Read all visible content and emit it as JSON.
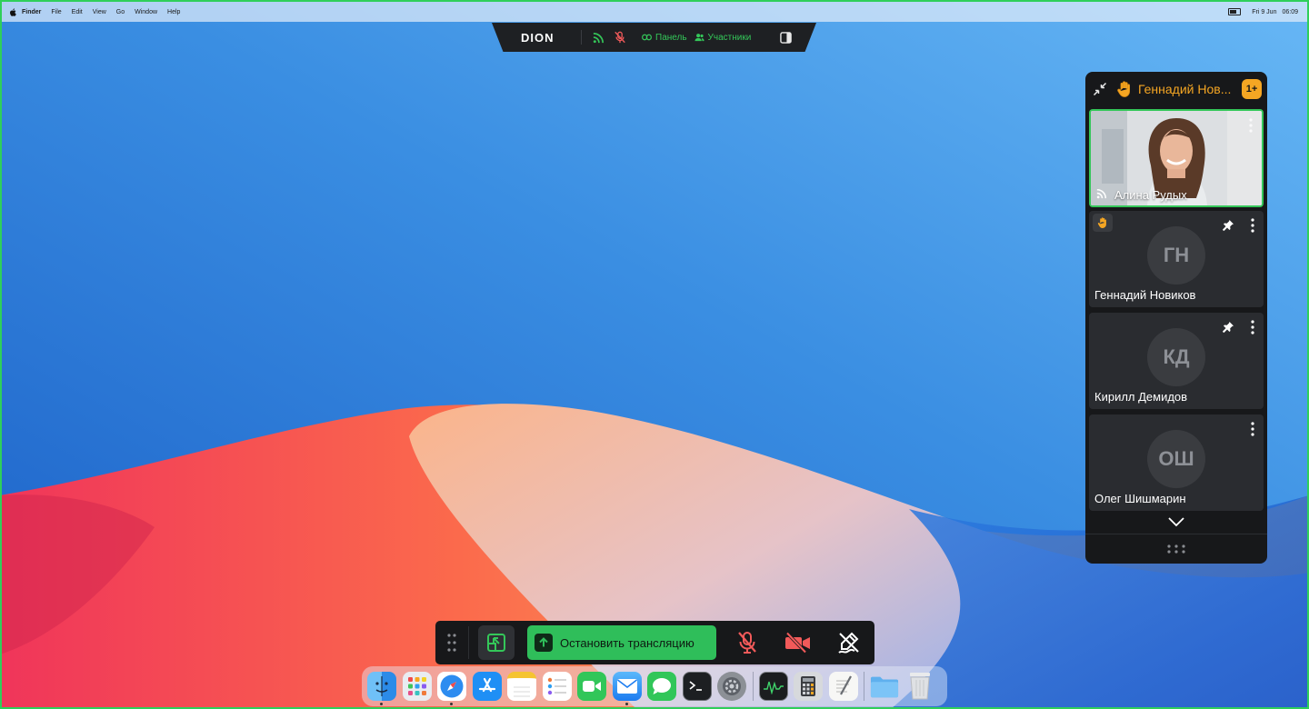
{
  "menubar": {
    "items": [
      "Finder",
      "File",
      "Edit",
      "View",
      "Go",
      "Window",
      "Help"
    ],
    "date": "Fri 9 Jun",
    "time": "06:09"
  },
  "topbar": {
    "logo": "DION",
    "panel_label": "Панель",
    "participants_label": "Участники",
    "accent": "#34c759"
  },
  "participants_panel": {
    "raised_hand_name": "Геннадий Нов...",
    "count_badge": "1+",
    "tiles": [
      {
        "name": "Алина Рудых",
        "type": "video",
        "speaking": true
      },
      {
        "name": "Геннадий Новиков",
        "initials": "ГН",
        "hand_raised": true,
        "pinned": true
      },
      {
        "name": "Кирилл Демидов",
        "initials": "КД",
        "pinned": true
      },
      {
        "name": "Олег Шишмарин",
        "initials": "ОШ"
      }
    ],
    "hand_color": "#f5a623"
  },
  "controls": {
    "stop_broadcast_label": "Остановить трансляцию",
    "mic_state": "muted",
    "camera_state": "off",
    "muted_color": "#f25a5a"
  },
  "dock": {
    "apps": [
      "Finder",
      "Launchpad",
      "Safari",
      "App Store",
      "Notes",
      "Reminders",
      "FaceTime",
      "Mail",
      "Messages",
      "Terminal",
      "System Settings",
      "Activity Monitor",
      "Calculator",
      "TextEdit",
      "Folder",
      "Trash"
    ]
  }
}
